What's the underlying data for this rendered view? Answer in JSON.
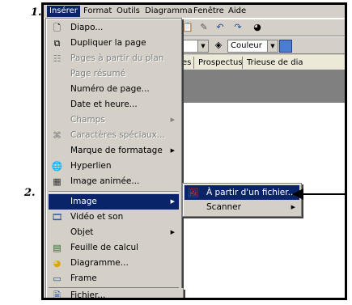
{
  "steps": {
    "first": "1.",
    "second": "2."
  },
  "menubar": {
    "items": [
      "Insérer",
      "Format",
      "Outils",
      "Diagramma",
      "Fenêtre",
      "Aide"
    ]
  },
  "toolbar": {
    "color_combo": "Couleur"
  },
  "tabs": [
    "es",
    "Prospectus",
    "Trieuse de dia"
  ],
  "menu": {
    "items": [
      {
        "label": "Diapo...",
        "icon": "new-slide-icon",
        "disabled": false,
        "submenu": false
      },
      {
        "label": "Dupliquer la page",
        "icon": "duplicate-page-icon",
        "disabled": false,
        "submenu": false
      },
      {
        "label": "Pages à partir du plan",
        "icon": "pages-from-outline-icon",
        "disabled": true,
        "submenu": false
      },
      {
        "label": "Page résumé",
        "icon": "",
        "disabled": true,
        "submenu": false
      },
      {
        "label": "Numéro de page...",
        "icon": "",
        "disabled": false,
        "submenu": false
      },
      {
        "label": "Date et heure...",
        "icon": "",
        "disabled": false,
        "submenu": false
      },
      {
        "label": "Champs",
        "icon": "",
        "disabled": true,
        "submenu": true
      },
      {
        "label": "Caractères spéciaux...",
        "icon": "special-characters-icon",
        "disabled": true,
        "submenu": false
      },
      {
        "label": "Marque de formatage",
        "icon": "",
        "disabled": false,
        "submenu": true
      },
      {
        "label": "Hyperlien",
        "icon": "hyperlink-icon",
        "disabled": false,
        "submenu": false
      },
      {
        "label": "Image animée...",
        "icon": "animated-image-icon",
        "disabled": false,
        "submenu": false
      },
      {
        "label": "Image",
        "icon": "",
        "disabled": false,
        "submenu": true,
        "highlighted": true
      },
      {
        "label": "Vidéo et son",
        "icon": "video-sound-icon",
        "disabled": false,
        "submenu": false
      },
      {
        "label": "Objet",
        "icon": "",
        "disabled": false,
        "submenu": true
      },
      {
        "label": "Feuille de calcul",
        "icon": "spreadsheet-icon",
        "disabled": false,
        "submenu": false
      },
      {
        "label": "Diagramme...",
        "icon": "chart-icon",
        "disabled": false,
        "submenu": false
      },
      {
        "label": "Frame",
        "icon": "frame-icon",
        "disabled": false,
        "submenu": false
      },
      {
        "label": "Fichier...",
        "icon": "insert-file-icon",
        "disabled": false,
        "submenu": false
      }
    ]
  },
  "submenu": {
    "items": [
      {
        "label": "À partir d'un fichier...",
        "icon": "from-file-icon",
        "highlighted": true
      },
      {
        "label": "Scanner",
        "submenu": true
      }
    ]
  },
  "colors": {
    "highlight": "#0a246a",
    "menu_bg": "#d4d0c8"
  }
}
